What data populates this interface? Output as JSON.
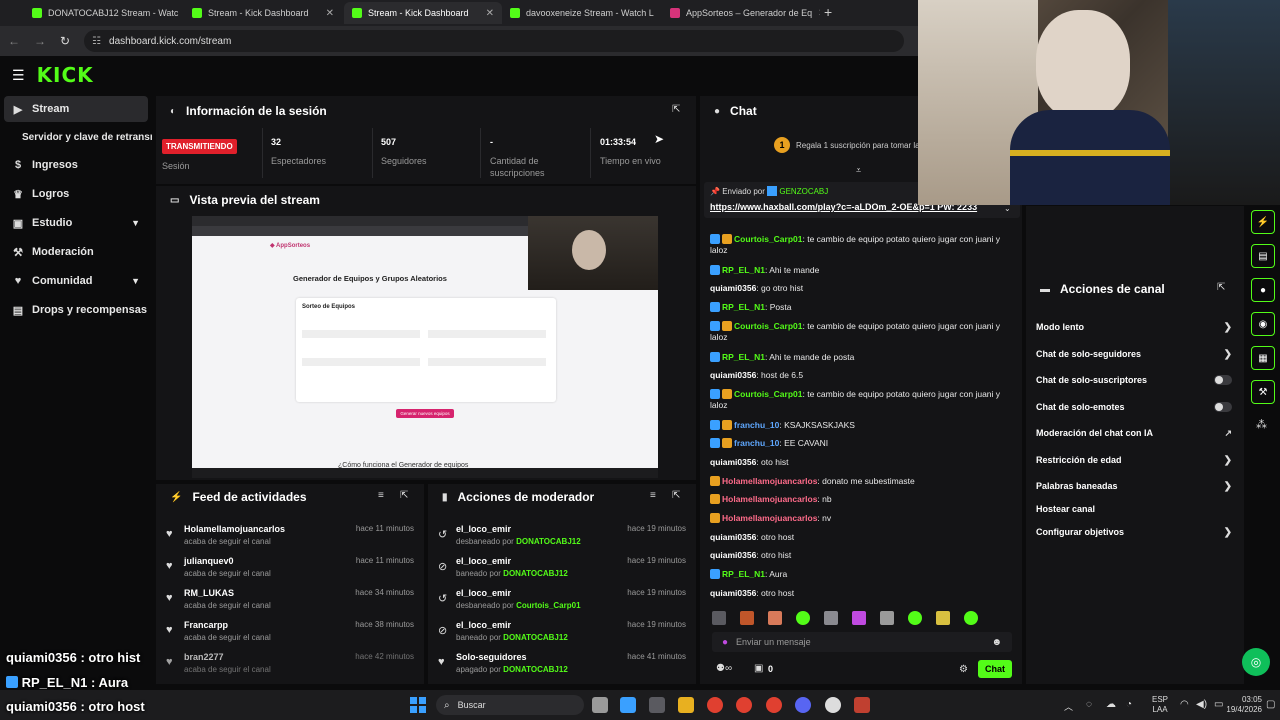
{
  "browser": {
    "tabs": [
      {
        "title": "DONATOCABJ12 Stream - Watc",
        "active": false
      },
      {
        "title": "Stream - Kick Dashboard",
        "active": false
      },
      {
        "title": "Stream - Kick Dashboard",
        "active": true
      },
      {
        "title": "davooxeneize Stream - Watch L",
        "active": false
      },
      {
        "title": "AppSorteos – Generador de Eq",
        "active": false
      }
    ],
    "url": "dashboard.kick.com/stream"
  },
  "app": {
    "logo": "KICK"
  },
  "sidebar": {
    "items": [
      {
        "label": "Stream",
        "icon": "play-icon"
      },
      {
        "label": "Servidor y clave de retransm",
        "icon": ""
      },
      {
        "label": "Ingresos",
        "icon": "dollar-icon"
      },
      {
        "label": "Logros",
        "icon": "trophy-icon"
      },
      {
        "label": "Estudio",
        "icon": "studio-icon"
      },
      {
        "label": "Moderación",
        "icon": "hammer-icon"
      },
      {
        "label": "Comunidad",
        "icon": "community-icon"
      },
      {
        "label": "Drops y recompensas",
        "icon": "gift-icon"
      }
    ]
  },
  "session": {
    "title": "Información de la sesión",
    "status_badge": "TRANSMITIENDO",
    "status_label": "Sesión",
    "stats": [
      {
        "value": "32",
        "label": "Espectadores"
      },
      {
        "value": "507",
        "label": "Seguidores"
      },
      {
        "value": "-",
        "label": "Cantidad de suscripciones"
      },
      {
        "value": "01:33:54",
        "label": "Tiempo en vivo"
      }
    ]
  },
  "preview": {
    "title": "Vista previa del stream",
    "site_title": "Generador de Equipos y Grupos Aleatorios",
    "card_title": "Sorteo de Equipos",
    "cta": "Generar nuevos equipos",
    "footer_text": "¿Cómo funciona el Generador de equipos"
  },
  "feed": {
    "title": "Feed de actividades",
    "items": [
      {
        "name": "Holamellamojuancarlos",
        "desc": "acaba de seguir el canal",
        "time": "hace 11 minutos"
      },
      {
        "name": "julianquev0",
        "desc": "acaba de seguir el canal",
        "time": "hace 11 minutos"
      },
      {
        "name": "RM_LUKAS",
        "desc": "acaba de seguir el canal",
        "time": "hace 34 minutos"
      },
      {
        "name": "Francarpp",
        "desc": "acaba de seguir el canal",
        "time": "hace 38 minutos"
      },
      {
        "name": "bran2277",
        "desc": "acaba de seguir el canal",
        "time": "hace 42 minutos"
      }
    ]
  },
  "modactions": {
    "title": "Acciones de moderador",
    "items": [
      {
        "name": "el_loco_emir",
        "desc": "desbaneado por",
        "target": "DONATOCABJ12",
        "time": "hace 19 minutos"
      },
      {
        "name": "el_loco_emir",
        "desc": "baneado por",
        "target": "DONATOCABJ12",
        "time": "hace 19 minutos"
      },
      {
        "name": "el_loco_emir",
        "desc": "desbaneado por",
        "target": "Courtois_Carp01",
        "time": "hace 19 minutos"
      },
      {
        "name": "el_loco_emir",
        "desc": "baneado por",
        "target": "DONATOCABJ12",
        "time": "hace 19 minutos"
      },
      {
        "name": "Solo-seguidores",
        "desc": "apagado por",
        "target": "DONATOCABJ12",
        "time": "hace 41 minutos"
      }
    ]
  },
  "chat": {
    "title": "Chat",
    "promo": "Regala 1 suscripción para tomar la p",
    "promo_count": "1",
    "pinned_prefix": "Enviado por",
    "pinned_by": "GENZOCABJ",
    "pinned_text": "https://www.haxball.com/play?c=-aLDOm_2-OE&p=1 PW: 2233",
    "messages": [
      {
        "user": "Courtois_Carp01",
        "color": "#53fc18",
        "badges": [
          "mod",
          "vip"
        ],
        "text": "te cambio de equipo potato quiero jugar con juani y laloz"
      },
      {
        "user": "RP_EL_N1",
        "color": "#53fc18",
        "badges": [
          "mod"
        ],
        "text": "Ahi te mande"
      },
      {
        "user": "quiami0356",
        "color": "#ffffff",
        "badges": [],
        "text": "go otro hist"
      },
      {
        "user": "RP_EL_N1",
        "color": "#53fc18",
        "badges": [
          "mod"
        ],
        "text": "Posta"
      },
      {
        "user": "Courtois_Carp01",
        "color": "#53fc18",
        "badges": [
          "mod",
          "vip"
        ],
        "text": "te cambio de equipo potato quiero jugar con juani y laloz"
      },
      {
        "user": "RP_EL_N1",
        "color": "#53fc18",
        "badges": [
          "mod"
        ],
        "text": "Ahi te mande de posta"
      },
      {
        "user": "quiami0356",
        "color": "#ffffff",
        "badges": [],
        "text": "host de 6.5"
      },
      {
        "user": "Courtois_Carp01",
        "color": "#53fc18",
        "badges": [
          "mod",
          "vip"
        ],
        "text": "te cambio de equipo potato quiero jugar con juani y laloz"
      },
      {
        "user": "franchu_10",
        "color": "#5fa8ff",
        "badges": [
          "mod",
          "vip"
        ],
        "text": "KSAJKSASKJAKS"
      },
      {
        "user": "franchu_10",
        "color": "#5fa8ff",
        "badges": [
          "mod",
          "vip"
        ],
        "text": "EE CAVANI"
      },
      {
        "user": "quiami0356",
        "color": "#ffffff",
        "badges": [],
        "text": "oto hist"
      },
      {
        "user": "Holamellamojuancarlos",
        "color": "#ff6b8a",
        "badges": [
          "vip"
        ],
        "text": "donato me subestimaste"
      },
      {
        "user": "Holamellamojuancarlos",
        "color": "#ff6b8a",
        "badges": [
          "vip"
        ],
        "text": "nb"
      },
      {
        "user": "Holamellamojuancarlos",
        "color": "#ff6b8a",
        "badges": [
          "vip"
        ],
        "text": "nv"
      },
      {
        "user": "quiami0356",
        "color": "#ffffff",
        "badges": [],
        "text": "otro host"
      },
      {
        "user": "quiami0356",
        "color": "#ffffff",
        "badges": [],
        "text": "otro hist"
      },
      {
        "user": "RP_EL_N1",
        "color": "#53fc18",
        "badges": [
          "mod"
        ],
        "text": "Aura"
      },
      {
        "user": "quiami0356",
        "color": "#ffffff",
        "badges": [],
        "text": "otro host"
      }
    ],
    "input_placeholder": "Enviar un mensaje",
    "points": "0",
    "send_label": "Chat"
  },
  "channel_actions": {
    "title": "Acciones de canal",
    "items": [
      {
        "label": "Modo lento",
        "control": "chevron"
      },
      {
        "label": "Chat de solo-seguidores",
        "control": "chevron"
      },
      {
        "label": "Chat de solo-suscriptores",
        "control": "toggle"
      },
      {
        "label": "Chat de solo-emotes",
        "control": "toggle"
      },
      {
        "label": "Moderación del chat con IA",
        "control": "link"
      },
      {
        "label": "Restricción de edad",
        "control": "chevron"
      },
      {
        "label": "Palabras baneadas",
        "control": "chevron"
      },
      {
        "label": "Hostear canal",
        "control": "none"
      },
      {
        "label": "Configurar objetivos",
        "control": "chevron"
      }
    ]
  },
  "overlay": {
    "lines": [
      {
        "user": "quiami0356",
        "text": ": otro hist"
      },
      {
        "user": "RP_EL_N1",
        "text": ": Aura"
      },
      {
        "user": "quiami0356",
        "text": ": otro host"
      }
    ]
  },
  "taskbar": {
    "search": "Buscar",
    "lang": "ESP",
    "region": "LAA",
    "time": "03:05",
    "date": "19/4/2026"
  },
  "colors": {
    "accent": "#53fc18",
    "live": "#e0202b"
  }
}
